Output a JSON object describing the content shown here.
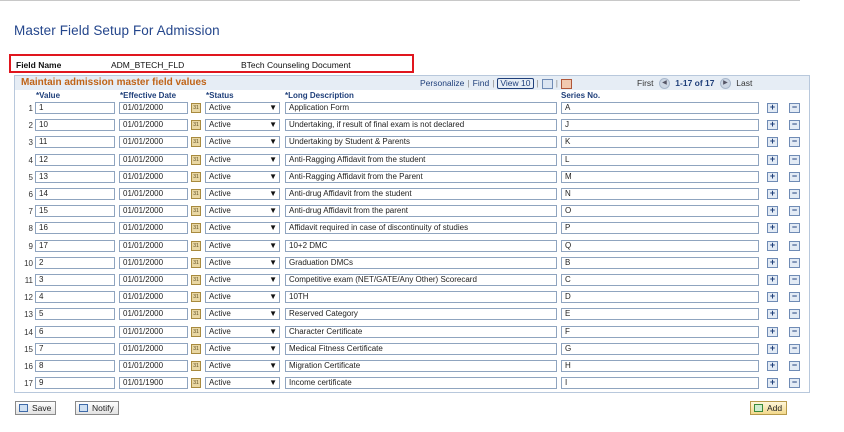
{
  "page": {
    "title": "Master Field Setup For Admission"
  },
  "field": {
    "name_label": "Field Name",
    "name_value": "ADM_BTECH_FLD",
    "description": "BTech Counseling Document"
  },
  "grid": {
    "title": "Maintain admission master field values",
    "nav": {
      "personalize": "Personalize",
      "find": "Find",
      "view": "View 10"
    },
    "pager": {
      "first": "First",
      "range": "1-17 of 17",
      "last": "Last"
    },
    "columns": {
      "value": "*Value",
      "effdate": "*Effective Date",
      "status": "*Status",
      "longdesc": "*Long Description",
      "series": "Series No."
    },
    "rows": [
      {
        "num": "1",
        "value": "1",
        "date": "01/01/2000",
        "status": "Active",
        "desc": "Application Form",
        "series": "A"
      },
      {
        "num": "2",
        "value": "10",
        "date": "01/01/2000",
        "status": "Active",
        "desc": "Undertaking, if result of final exam is not declared",
        "series": "J"
      },
      {
        "num": "3",
        "value": "11",
        "date": "01/01/2000",
        "status": "Active",
        "desc": "Undertaking by Student & Parents",
        "series": "K"
      },
      {
        "num": "4",
        "value": "12",
        "date": "01/01/2000",
        "status": "Active",
        "desc": "Anti-Ragging Affidavit from the student",
        "series": "L"
      },
      {
        "num": "5",
        "value": "13",
        "date": "01/01/2000",
        "status": "Active",
        "desc": "Anti-Ragging Affidavit from the Parent",
        "series": "M"
      },
      {
        "num": "6",
        "value": "14",
        "date": "01/01/2000",
        "status": "Active",
        "desc": "Anti-drug Affidavit from the student",
        "series": "N"
      },
      {
        "num": "7",
        "value": "15",
        "date": "01/01/2000",
        "status": "Active",
        "desc": "Anti-drug Affidavit from the parent",
        "series": "O"
      },
      {
        "num": "8",
        "value": "16",
        "date": "01/01/2000",
        "status": "Active",
        "desc": "Affidavit required in case of discontinuity of studies",
        "series": "P"
      },
      {
        "num": "9",
        "value": "17",
        "date": "01/01/2000",
        "status": "Active",
        "desc": "10+2 DMC",
        "series": "Q"
      },
      {
        "num": "10",
        "value": "2",
        "date": "01/01/2000",
        "status": "Active",
        "desc": "Graduation DMCs",
        "series": "B"
      },
      {
        "num": "11",
        "value": "3",
        "date": "01/01/2000",
        "status": "Active",
        "desc": "Competitive exam (NET/GATE/Any Other) Scorecard",
        "series": "C"
      },
      {
        "num": "12",
        "value": "4",
        "date": "01/01/2000",
        "status": "Active",
        "desc": "10TH",
        "series": "D"
      },
      {
        "num": "13",
        "value": "5",
        "date": "01/01/2000",
        "status": "Active",
        "desc": "Reserved Category",
        "series": "E"
      },
      {
        "num": "14",
        "value": "6",
        "date": "01/01/2000",
        "status": "Active",
        "desc": "Character Certificate",
        "series": "F"
      },
      {
        "num": "15",
        "value": "7",
        "date": "01/01/2000",
        "status": "Active",
        "desc": "Medical Fitness Certificate",
        "series": "G"
      },
      {
        "num": "16",
        "value": "8",
        "date": "01/01/2000",
        "status": "Active",
        "desc": "Migration Certificate",
        "series": "H"
      },
      {
        "num": "17",
        "value": "9",
        "date": "01/01/1900",
        "status": "Active",
        "desc": "Income certificate",
        "series": "I"
      }
    ]
  },
  "toolbar": {
    "save": "Save",
    "notify": "Notify",
    "add": "Add"
  },
  "icons": {
    "calendar": "calendar-icon",
    "add_row": "plus-icon",
    "delete_row": "minus-icon",
    "chevron": "chevron-down-icon"
  },
  "colors": {
    "title": "#24468c",
    "grid_title": "#c06418",
    "highlight_border": "#e0161e"
  }
}
